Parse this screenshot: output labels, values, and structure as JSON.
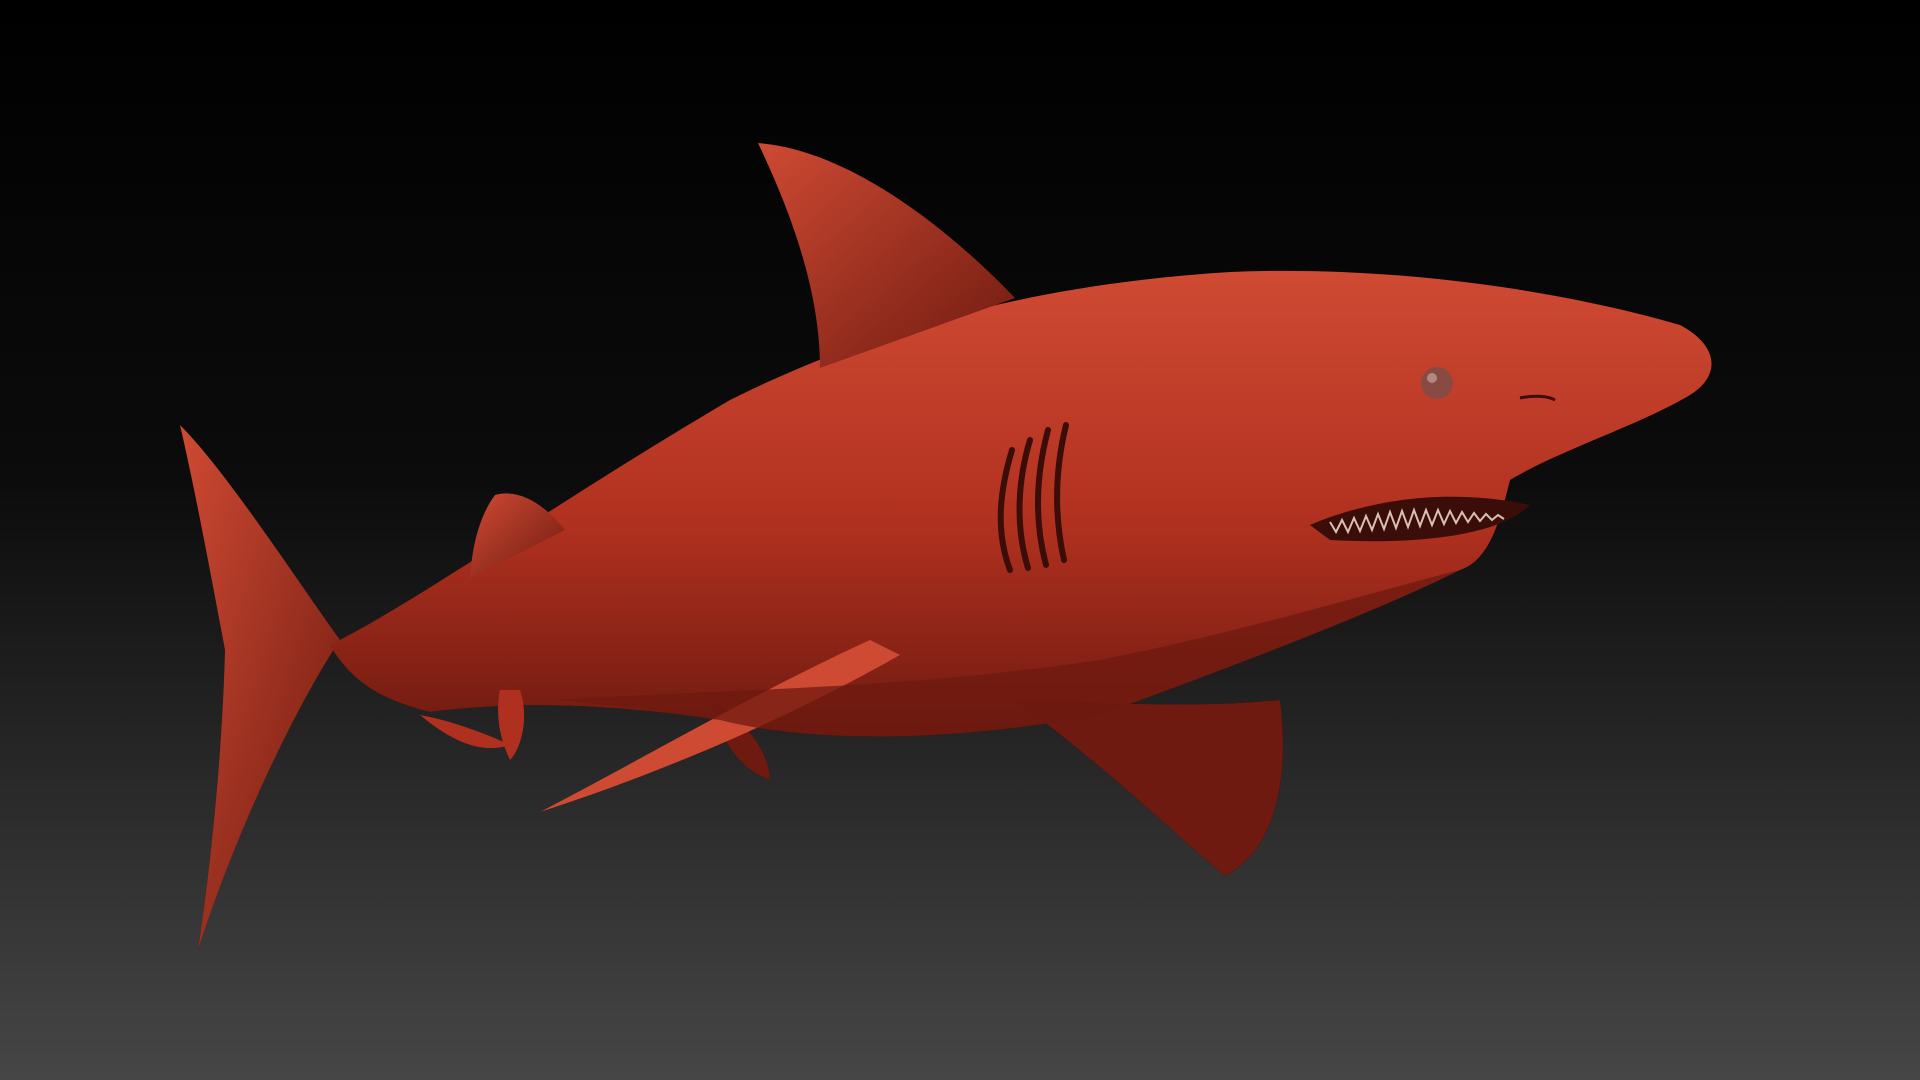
{
  "viewport": {
    "background_top": "#000000",
    "background_mid": "#0c0c0c",
    "background_bottom": "#464646"
  },
  "model": {
    "subject": "shark",
    "material_base": "#b0301f",
    "material_light": "#cf4a33",
    "material_shadow": "#6e1a10",
    "wire_color": "#3a0d08",
    "eye_color": "#8a4a44",
    "teeth_color": "#d9c0b4"
  }
}
